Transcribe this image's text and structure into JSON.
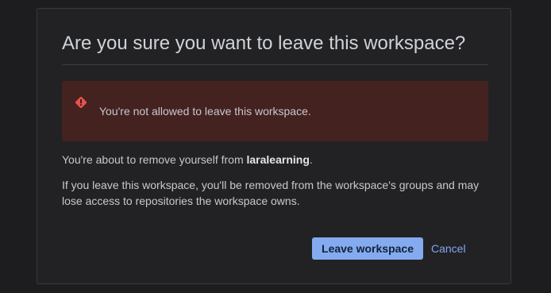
{
  "dialog": {
    "title": "Are you sure you want to leave this workspace?",
    "error_banner": {
      "icon": "error-diamond-icon",
      "message": "You're not allowed to leave this workspace."
    },
    "body": {
      "remove_prefix": "You're about to remove yourself from ",
      "workspace_name": "laralearning",
      "remove_suffix": ".",
      "warning": "If you leave this workspace, you'll be removed from the workspace's groups and may lose access to repositories the workspace owns."
    },
    "actions": {
      "confirm_label": "Leave workspace",
      "cancel_label": "Cancel"
    }
  },
  "colors": {
    "background": "#1d1d1f",
    "dialog_bg": "#222224",
    "error_bg": "#442220",
    "error_icon": "#e5534b",
    "primary_button": "#84abef",
    "link": "#7fa6ee"
  }
}
